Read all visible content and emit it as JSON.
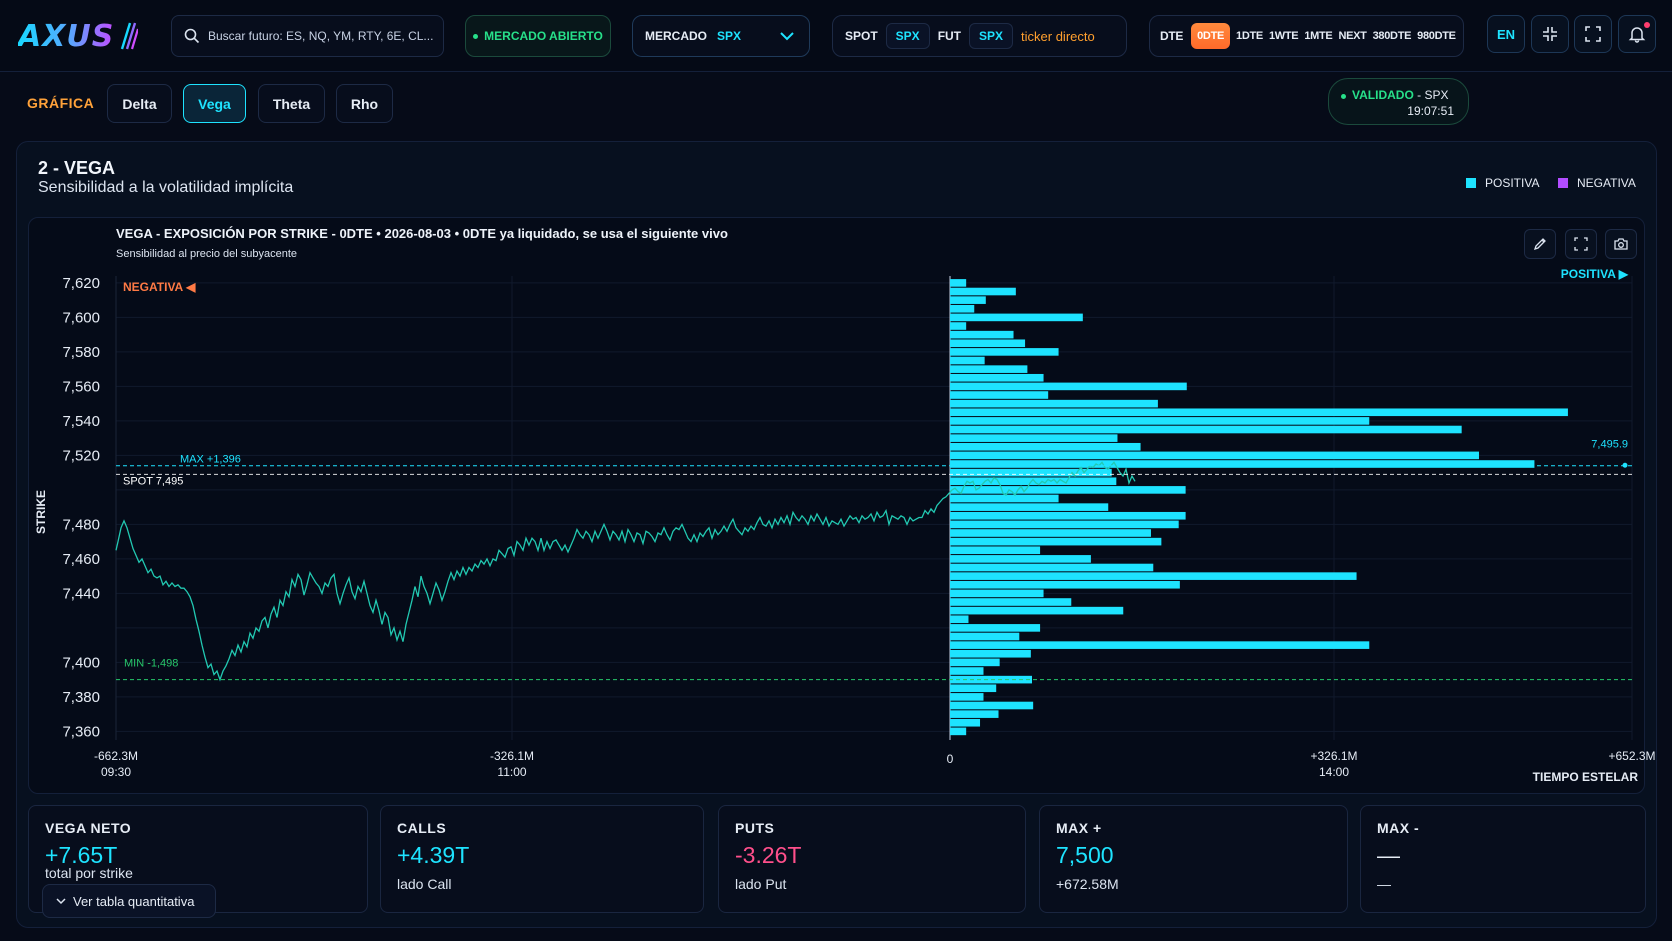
{
  "brand": {
    "logo_text": "AXUS"
  },
  "topbar": {
    "search_placeholder": "Buscar futuro: ES, NQ, YM, RTY, 6E, CL...",
    "market_status": "MERCADO ABIERTO",
    "market_label": "MERCADO",
    "market_value": "SPX",
    "spot_label": "SPOT",
    "spot_value": "SPX",
    "fut_label": "FUT",
    "fut_value": "SPX",
    "ticker_link": "ticker directo",
    "dte_label": "DTE",
    "dte_options": [
      "0DTE",
      "1DTE",
      "1WTE",
      "1MTE",
      "NEXT",
      "380DTE",
      "980DTE"
    ],
    "dte_active": "0DTE",
    "lang_button": "EN"
  },
  "nav": {
    "section_label": "GRÁFICA",
    "tabs": [
      "Delta",
      "Vega",
      "Theta",
      "Rho"
    ],
    "active_tab": "Vega",
    "validation_status": "VALIDADO",
    "validation_symbol": "SPX",
    "validation_time": "19:07:51"
  },
  "panel": {
    "title": "2 - VEGA",
    "subtitle": "Sensibilidad a la volatilidad implícita",
    "legend_positive": "POSITIVA",
    "legend_negative": "NEGATIVA",
    "colors": {
      "positive": "#1ee3ff",
      "negative": "#b24dff",
      "price_line": "#22c9b2",
      "max_line": "#1ee3ff",
      "min_line": "#27c76a",
      "spot_line": "#ffffff"
    }
  },
  "chart_data": {
    "type": "bar",
    "orientation": "horizontal",
    "title": "VEGA - EXPOSICIÓN POR STRIKE - 0DTE",
    "date": "2026-08-03",
    "note": "0DTE ya liquidado, se usa el siguiente vivo",
    "subtitle": "Sensibilidad al precio del subyacente",
    "ylabel": "STRIKE",
    "xlabel": "TIEMPO ESTELAR",
    "ylim": [
      7355,
      7624
    ],
    "xlim": [
      -662.3,
      652.3
    ],
    "y_ticks": [
      7620,
      7600,
      7580,
      7560,
      7540,
      7520,
      7500,
      7480,
      7460,
      7440,
      7420,
      7400,
      7380,
      7360
    ],
    "y_tick_labels": [
      "7,620",
      "7,600",
      "7,580",
      "7,560",
      "7,540",
      "7,520",
      "",
      "7,480",
      "7,460",
      "7,440",
      "",
      "7,400",
      "7,380",
      "7,360"
    ],
    "x_ticks": [
      {
        "value": -662.3,
        "label": "-662.3M",
        "time": "09:30"
      },
      {
        "value": -326.1,
        "label": "-326.1M",
        "time": "11:00"
      },
      {
        "value": 0,
        "label": "0",
        "time": ""
      },
      {
        "value": 326.1,
        "label": "+326.1M",
        "time": "14:00"
      },
      {
        "value": 652.3,
        "label": "+652.3M",
        "time": ""
      }
    ],
    "negative_side_label": "NEGATIVA ◀",
    "positive_side_label": "POSITIVA ▶",
    "strikes": [
      7620,
      7615,
      7610,
      7605,
      7600,
      7595,
      7590,
      7585,
      7580,
      7575,
      7570,
      7565,
      7560,
      7555,
      7550,
      7545,
      7540,
      7535,
      7530,
      7525,
      7520,
      7515,
      7510,
      7505,
      7500,
      7495,
      7490,
      7485,
      7480,
      7475,
      7470,
      7465,
      7460,
      7455,
      7450,
      7445,
      7440,
      7435,
      7430,
      7425,
      7420,
      7415,
      7410,
      7405,
      7400,
      7395,
      7390,
      7385,
      7380,
      7375,
      7370,
      7365,
      7360
    ],
    "values": [
      14,
      57,
      31,
      21,
      115,
      14,
      55,
      65,
      94,
      30,
      67,
      81,
      205,
      85,
      180,
      535,
      363,
      443,
      145,
      165,
      458,
      506,
      140,
      144,
      204,
      94,
      137,
      204,
      198,
      174,
      183,
      78,
      122,
      176,
      352,
      199,
      81,
      105,
      150,
      16,
      78,
      60,
      363,
      70,
      43,
      29,
      71,
      40,
      29,
      72,
      42,
      26,
      14
    ],
    "annotations": [
      {
        "label": "MAX +1,396",
        "strike": 7514
      },
      {
        "label": "SPOT 7,495",
        "strike": 7509
      },
      {
        "label": "MIN -1,498",
        "strike": 7390
      },
      {
        "label": "7,495.9",
        "strike": 7516
      }
    ],
    "price_series_time": [
      0,
      2,
      5,
      8,
      11,
      14,
      17,
      20,
      23,
      26,
      29,
      32,
      35,
      38,
      41,
      44,
      47,
      50,
      53,
      56,
      59,
      62,
      65,
      68,
      71,
      74,
      77,
      80,
      83,
      86,
      89,
      92,
      95,
      98,
      101,
      104,
      107,
      110,
      113,
      116,
      119,
      122,
      125,
      128,
      131,
      134,
      137,
      140,
      143,
      146,
      149,
      152,
      155,
      158,
      161,
      164,
      167,
      170,
      173,
      176,
      179,
      182,
      185,
      188,
      191,
      194,
      197,
      200,
      203,
      206,
      209,
      212,
      215,
      218,
      221,
      224,
      227,
      230,
      233,
      236,
      239,
      242,
      245,
      248,
      251,
      254,
      257,
      260,
      263,
      266,
      269,
      272,
      275,
      278,
      281,
      284,
      287,
      290,
      293,
      296,
      299,
      302,
      305,
      308,
      311,
      314,
      317,
      320,
      323,
      326,
      329,
      332,
      335,
      338,
      341,
      344,
      347,
      350,
      353,
      356,
      359,
      362,
      365,
      368,
      371,
      374,
      377,
      380,
      383,
      386,
      389,
      392,
      395,
      398,
      401,
      404,
      407,
      410,
      413,
      416,
      419,
      422,
      425,
      428,
      431,
      434,
      437,
      440,
      443,
      446,
      449,
      452,
      455,
      458,
      461,
      464,
      467,
      470,
      473,
      476,
      479,
      482,
      485,
      488,
      491,
      494,
      497,
      500,
      503,
      506,
      509,
      512,
      515,
      518,
      521,
      524,
      527,
      530,
      533,
      536,
      539,
      542,
      545,
      548,
      551,
      554,
      557,
      560,
      563,
      566,
      569,
      572,
      575,
      578,
      581,
      584,
      587,
      590,
      593,
      596,
      599,
      602,
      605,
      608,
      611,
      614,
      617,
      620,
      623,
      626,
      629,
      632,
      635,
      638,
      641,
      644,
      647,
      650,
      653,
      656,
      659,
      662,
      665,
      668,
      671,
      674,
      677,
      680,
      683,
      686,
      689,
      692,
      695,
      698,
      701,
      704,
      707,
      710,
      713,
      716,
      719,
      722,
      725,
      728,
      731,
      734,
      737,
      740,
      743,
      746,
      749,
      752,
      755,
      758,
      761,
      764,
      767,
      770,
      773,
      776,
      779,
      782,
      785,
      788,
      791,
      794,
      797,
      800,
      803,
      806,
      809,
      812,
      815,
      818,
      821,
      824,
      827,
      830,
      833,
      836,
      839,
      842,
      845,
      848,
      851,
      854,
      857,
      860,
      863,
      866,
      869,
      872,
      875,
      878,
      881,
      884,
      887,
      890,
      893,
      896,
      899,
      902,
      905,
      908,
      911,
      914,
      917,
      920,
      923,
      926,
      929,
      932,
      935,
      938,
      941,
      944,
      947,
      950,
      953,
      956,
      959,
      962,
      965,
      968,
      971,
      974,
      977,
      980,
      983,
      986,
      989,
      992,
      995,
      998,
      1001,
      1004,
      1007,
      1010,
      1013,
      1016,
      1019,
      1022,
      1025,
      1028,
      1031,
      1034,
      1037,
      1040,
      1043,
      1046,
      1049,
      1052,
      1055,
      1058,
      1061,
      1064,
      1067,
      1070,
      1073,
      1076,
      1079,
      1082,
      1085,
      1088,
      1091,
      1094,
      1097,
      1100,
      1103,
      1106,
      1109,
      1112,
      1115,
      1118,
      1121,
      1124,
      1127,
      1130,
      1133,
      1136,
      1139,
      1142,
      1145,
      1148,
      1151,
      1154,
      1157,
      1160,
      1163,
      1166,
      1169,
      1172,
      1175,
      1178,
      1181,
      1184,
      1187,
      1190,
      1193,
      1196,
      1199,
      1202,
      1205,
      1208,
      1211,
      1214,
      1217,
      1220,
      1223,
      1226,
      1229,
      1232,
      1235,
      1238,
      1241,
      1244,
      1247,
      1250,
      1253,
      1256,
      1259,
      1262,
      1265,
      1268,
      1271,
      1274,
      1277,
      1280,
      1283,
      1286,
      1289,
      1292,
      1295,
      1298,
      1301,
      1304,
      1307,
      1310,
      1313,
      1316
    ],
    "price_series_values": [
      7465,
      7470,
      7478,
      7482,
      7478,
      7472,
      7466,
      7462,
      7458,
      7460,
      7456,
      7452,
      7454,
      7450,
      7449,
      7450,
      7445,
      7447,
      7444,
      7446,
      7444,
      7445,
      7443,
      7443,
      7441,
      7438,
      7433,
      7425,
      7418,
      7410,
      7403,
      7397,
      7399,
      7393,
      7395,
      7390,
      7395,
      7398,
      7402,
      7407,
      7404,
      7410,
      7406,
      7412,
      7409,
      7417,
      7414,
      7420,
      7418,
      7424,
      7426,
      7420,
      7428,
      7432,
      7426,
      7436,
      7433,
      7441,
      7438,
      7448,
      7444,
      7451,
      7448,
      7439,
      7445,
      7452,
      7449,
      7446,
      7444,
      7440,
      7446,
      7444,
      7449,
      7451,
      7440,
      7434,
      7440,
      7445,
      7449,
      7441,
      7437,
      7444,
      7441,
      7447,
      7440,
      7433,
      7429,
      7436,
      7430,
      7422,
      7429,
      7426,
      7416,
      7420,
      7413,
      7418,
      7412,
      7422,
      7429,
      7436,
      7444,
      7438,
      7450,
      7444,
      7440,
      7434,
      7440,
      7446,
      7442,
      7436,
      7441,
      7447,
      7452,
      7448,
      7453,
      7450,
      7455,
      7451,
      7455,
      7453,
      7457,
      7455,
      7459,
      7457,
      7460,
      7456,
      7460,
      7459,
      7465,
      7463,
      7461,
      7466,
      7467,
      7462,
      7470,
      7468,
      7465,
      7472,
      7468,
      7472,
      7470,
      7465,
      7472,
      7465,
      7470,
      7466,
      7470,
      7471,
      7468,
      7465,
      7468,
      7464,
      7468,
      7472,
      7477,
      7474,
      7472,
      7476,
      7474,
      7470,
      7476,
      7472,
      7476,
      7480,
      7476,
      7471,
      7476,
      7474,
      7471,
      7476,
      7470,
      7477,
      7474,
      7470,
      7475,
      7474,
      7469,
      7476,
      7475,
      7473,
      7470,
      7475,
      7474,
      7478,
      7474,
      7471,
      7476,
      7478,
      7477,
      7480,
      7476,
      7472,
      7470,
      7474,
      7470,
      7475,
      7473,
      7476,
      7478,
      7472,
      7477,
      7474,
      7476,
      7479,
      7476,
      7480,
      7483,
      7478,
      7476,
      7474,
      7478,
      7476,
      7479,
      7477,
      7481,
      7484,
      7480,
      7479,
      7482,
      7478,
      7483,
      7480,
      7484,
      7481,
      7485,
      7480,
      7487,
      7484,
      7482,
      7485,
      7483,
      7480,
      7485,
      7482,
      7486,
      7483,
      7480,
      7484,
      7479,
      7482,
      7481,
      7480,
      7483,
      7479,
      7482,
      7485,
      7483,
      7484,
      7481,
      7485,
      7483,
      7484,
      7486,
      7482,
      7487,
      7484,
      7485,
      7488,
      7480,
      7485,
      7484,
      7483,
      7485,
      7484,
      7480,
      7484,
      7482,
      7483,
      7484,
      7484,
      7488,
      7486,
      7489,
      7487,
      7491,
      7493,
      7495,
      7496,
      7498,
      7500,
      7501,
      7499,
      7498,
      7502,
      7505,
      7504,
      7505,
      7500,
      7501,
      7503,
      7505,
      7506,
      7504,
      7507,
      7506,
      7503,
      7498,
      7497,
      7500,
      7499,
      7497,
      7500,
      7502,
      7499,
      7501,
      7504,
      7506,
      7504,
      7503,
      7505,
      7504,
      7506,
      7505,
      7506,
      7504,
      7506,
      7505,
      7504,
      7507,
      7510,
      7508,
      7511,
      7513,
      7510,
      7512,
      7514,
      7513,
      7515,
      7514,
      7516,
      7513,
      7512,
      7514,
      7516,
      7513,
      7510,
      7508,
      7512,
      7504,
      7508,
      7505
    ]
  },
  "stats": {
    "net": {
      "label": "VEGA NETO",
      "value": "+7.65T",
      "sub": "total por strike"
    },
    "calls": {
      "label": "CALLS",
      "value": "+4.39T",
      "sub": "lado Call"
    },
    "puts": {
      "label": "PUTS",
      "value": "-3.26T",
      "sub": "lado Put"
    },
    "max_pos": {
      "label": "MAX +",
      "value": "7,500",
      "sub": "+672.58M"
    },
    "max_neg": {
      "label": "MAX -",
      "value": "—",
      "sub": "—"
    },
    "toggle_label": "Ver tabla quantitativa"
  }
}
